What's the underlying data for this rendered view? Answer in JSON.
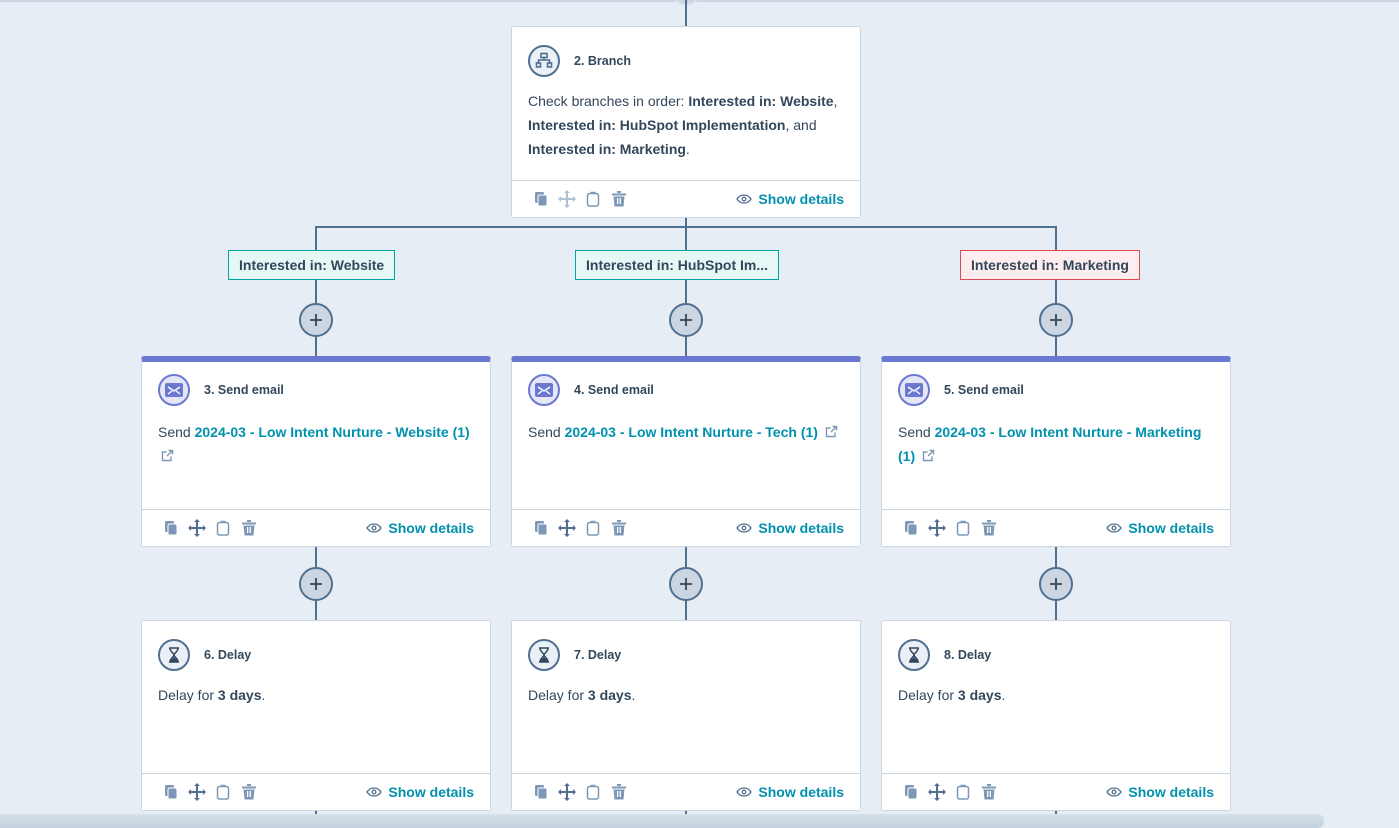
{
  "colors": {
    "background": "#e6edf5",
    "connector": "#516f90",
    "email_accent": "#6a78d1",
    "link": "#0091ae",
    "branch_teal": "#00a4a4",
    "branch_red": "#d94c53"
  },
  "branch_action": {
    "title": "2. Branch",
    "icon": "branch-icon",
    "description_prefix": "Check branches in order: ",
    "b1": "Interested in: Website",
    "sep1": ", ",
    "b2": "Interested in: HubSpot Implementation",
    "sep2": ", and ",
    "b3": "Interested in: Marketing",
    "end": ".",
    "show_details": "Show details"
  },
  "branches": [
    {
      "label": "Interested in: Website",
      "status": "teal"
    },
    {
      "label": "Interested in: HubSpot Im...",
      "status": "teal"
    },
    {
      "label": "Interested in: Marketing",
      "status": "red"
    }
  ],
  "email_actions": [
    {
      "title": "3. Send email",
      "prefix": "Send ",
      "email_name": "2024-03 - Low Intent Nurture - Website (1)",
      "show_details": "Show details"
    },
    {
      "title": "4. Send email",
      "prefix": "Send ",
      "email_name": "2024-03 - Low Intent Nurture - Tech (1)",
      "show_details": "Show details"
    },
    {
      "title": "5. Send email",
      "prefix": "Send ",
      "email_name": "2024-03 - Low Intent Nurture - Marketing (1)",
      "show_details": "Show details"
    }
  ],
  "delay_actions": [
    {
      "title": "6. Delay",
      "prefix": "Delay for ",
      "duration": "3 days",
      "end": ".",
      "show_details": "Show details"
    },
    {
      "title": "7. Delay",
      "prefix": "Delay for ",
      "duration": "3 days",
      "end": ".",
      "show_details": "Show details"
    },
    {
      "title": "8. Delay",
      "prefix": "Delay for ",
      "duration": "3 days",
      "end": ".",
      "show_details": "Show details"
    }
  ],
  "toolbar_icons": [
    "copy-icon",
    "move-icon",
    "clipboard-icon",
    "trash-icon"
  ]
}
